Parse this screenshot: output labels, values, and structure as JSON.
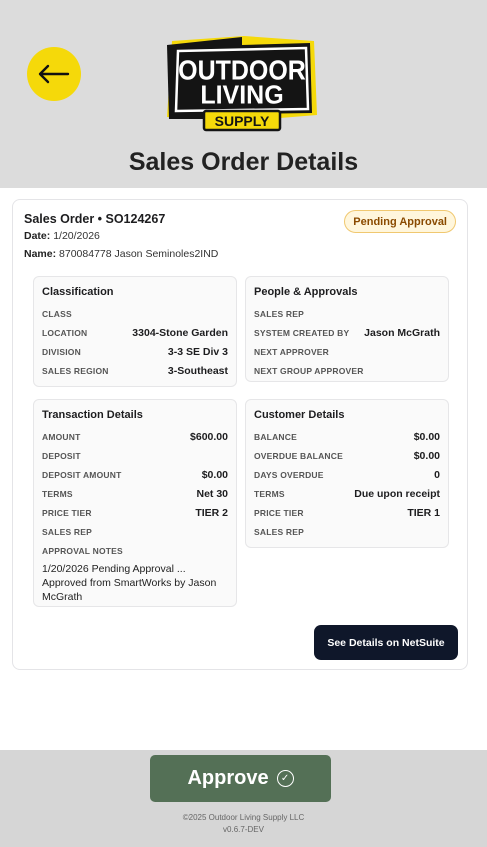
{
  "app": {
    "title": "Sales Order Details",
    "logo_lines": [
      "OUTDOOR",
      "LIVING",
      "SUPPLY"
    ],
    "colors": {
      "accent": "#f5d90a",
      "approve": "#547056",
      "dark": "#0f172a"
    }
  },
  "order": {
    "title": "Sales Order • SO124267",
    "date_label": "Date:",
    "date": "1/20/2026",
    "name_label": "Name:",
    "name": "870084778 Jason Seminoles2IND",
    "status": "Pending Approval"
  },
  "classification": {
    "heading": "Classification",
    "rows": [
      {
        "label": "CLASS",
        "value": ""
      },
      {
        "label": "LOCATION",
        "value": "3304-Stone Garden"
      },
      {
        "label": "DIVISION",
        "value": "3-3 SE Div 3"
      },
      {
        "label": "SALES REGION",
        "value": "3-Southeast"
      }
    ]
  },
  "people": {
    "heading": "People & Approvals",
    "rows": [
      {
        "label": "SALES REP",
        "value": ""
      },
      {
        "label": "SYSTEM CREATED BY",
        "value": "Jason McGrath"
      },
      {
        "label": "NEXT APPROVER",
        "value": ""
      },
      {
        "label": "NEXT GROUP APPROVER",
        "value": ""
      }
    ]
  },
  "transaction": {
    "heading": "Transaction Details",
    "rows": [
      {
        "label": "AMOUNT",
        "value": "$600.00"
      },
      {
        "label": "DEPOSIT",
        "value": ""
      },
      {
        "label": "DEPOSIT AMOUNT",
        "value": "$0.00"
      },
      {
        "label": "TERMS",
        "value": "Net 30"
      },
      {
        "label": "PRICE TIER",
        "value": "TIER 2"
      },
      {
        "label": "SALES REP",
        "value": ""
      },
      {
        "label": "APPROVAL NOTES",
        "value": ""
      }
    ],
    "approval_notes": "1/20/2026 Pending Approval ... Approved from SmartWorks by Jason McGrath"
  },
  "customer": {
    "heading": "Customer Details",
    "rows": [
      {
        "label": "BALANCE",
        "value": "$0.00"
      },
      {
        "label": "OVERDUE BALANCE",
        "value": "$0.00"
      },
      {
        "label": "DAYS OVERDUE",
        "value": "0"
      },
      {
        "label": "TERMS",
        "value": "Due upon receipt"
      },
      {
        "label": "PRICE TIER",
        "value": "TIER 1"
      },
      {
        "label": "SALES REP",
        "value": ""
      }
    ]
  },
  "actions": {
    "netsuite_label": "See Details on NetSuite",
    "approve_label": "Approve"
  },
  "footer": {
    "copyright": "©2025 Outdoor Living Supply LLC",
    "version": "v0.6.7-DEV"
  }
}
